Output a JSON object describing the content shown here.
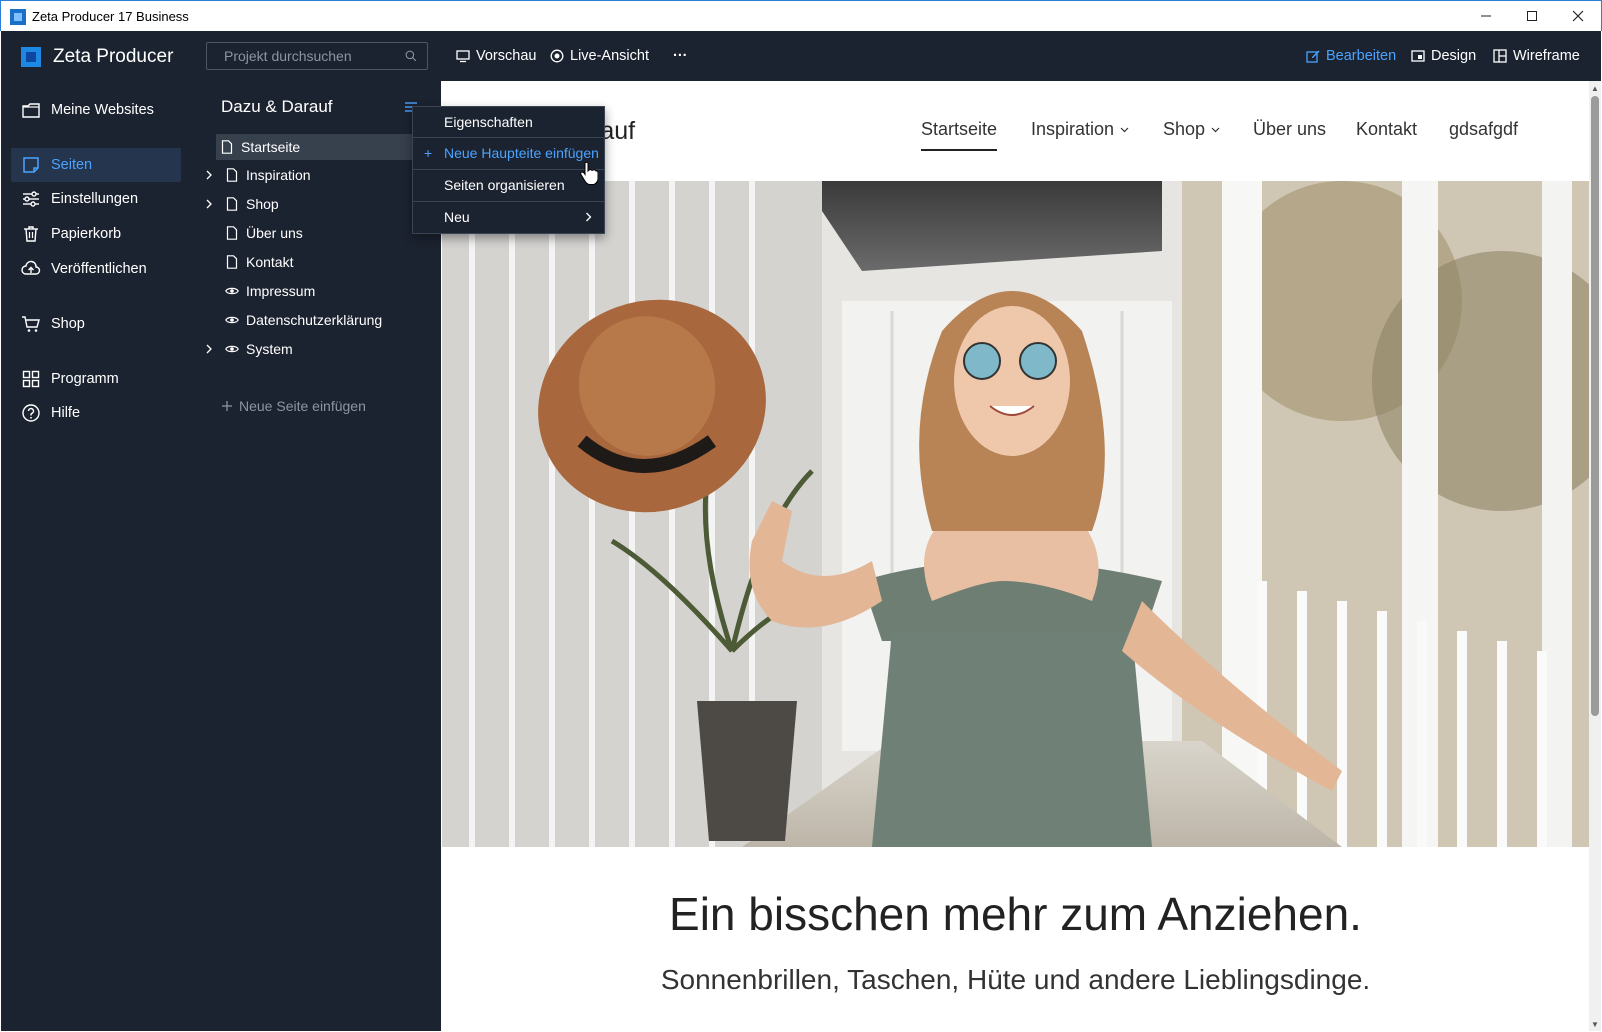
{
  "window": {
    "title": "Zeta Producer 17 Business",
    "minimize": "—",
    "maximize": "☐",
    "close": "✕"
  },
  "sidebar": {
    "brand": "Zeta Producer",
    "items": [
      {
        "label": "Meine Websites",
        "icon": "folder-icon"
      },
      {
        "label": "Seiten",
        "icon": "pages-icon",
        "active": true
      },
      {
        "label": "Einstellungen",
        "icon": "sliders-icon"
      },
      {
        "label": "Papierkorb",
        "icon": "trash-icon"
      },
      {
        "label": "Veröffentlichen",
        "icon": "cloud-upload-icon"
      },
      {
        "label": "Shop",
        "icon": "cart-icon"
      },
      {
        "label": "Programm",
        "icon": "grid-icon"
      },
      {
        "label": "Hilfe",
        "icon": "help-icon"
      }
    ]
  },
  "pages_panel": {
    "search_placeholder": "Projekt durchsuchen",
    "project_title": "Dazu & Darauf",
    "tree": [
      {
        "label": "Startseite",
        "type": "page",
        "expandable": false,
        "selected": true
      },
      {
        "label": "Inspiration",
        "type": "page",
        "expandable": true
      },
      {
        "label": "Shop",
        "type": "page",
        "expandable": true
      },
      {
        "label": "Über uns",
        "type": "page",
        "expandable": false
      },
      {
        "label": "Kontakt",
        "type": "page",
        "expandable": false
      },
      {
        "label": "Impressum",
        "type": "hidden",
        "expandable": false
      },
      {
        "label": "Datenschutzerklärung",
        "type": "hidden",
        "expandable": false
      },
      {
        "label": "System",
        "type": "hidden",
        "expandable": true
      }
    ],
    "add_page": "Neue Seite einfügen"
  },
  "toolbar": {
    "preview": "Vorschau",
    "live_view": "Live-Ansicht",
    "more": "···",
    "edit": "Bearbeiten",
    "design": "Design",
    "wireframe": "Wireframe"
  },
  "context_menu": {
    "items": [
      {
        "label": "Eigenschaften"
      },
      {
        "label": "Neue Haupteite einfügen",
        "prefix": "+",
        "hover": true
      },
      {
        "label": "Seiten organisieren"
      },
      {
        "label": "Neu",
        "submenu": true
      }
    ]
  },
  "website": {
    "logo_fragment": "rauf",
    "nav": [
      {
        "label": "Startseite",
        "current": true
      },
      {
        "label": "Inspiration",
        "dropdown": true
      },
      {
        "label": "Shop",
        "dropdown": true
      },
      {
        "label": "Über uns"
      },
      {
        "label": "Kontakt"
      },
      {
        "label": "gdsafgdf"
      }
    ],
    "headline": "Ein bisschen mehr zum Anziehen.",
    "subline": "Sonnenbrillen, Taschen, Hüte und andere Lieblingsdinge."
  },
  "colors": {
    "dark_bg": "#1c2330",
    "accent": "#4aa3ff",
    "active_bg": "#24354d"
  }
}
